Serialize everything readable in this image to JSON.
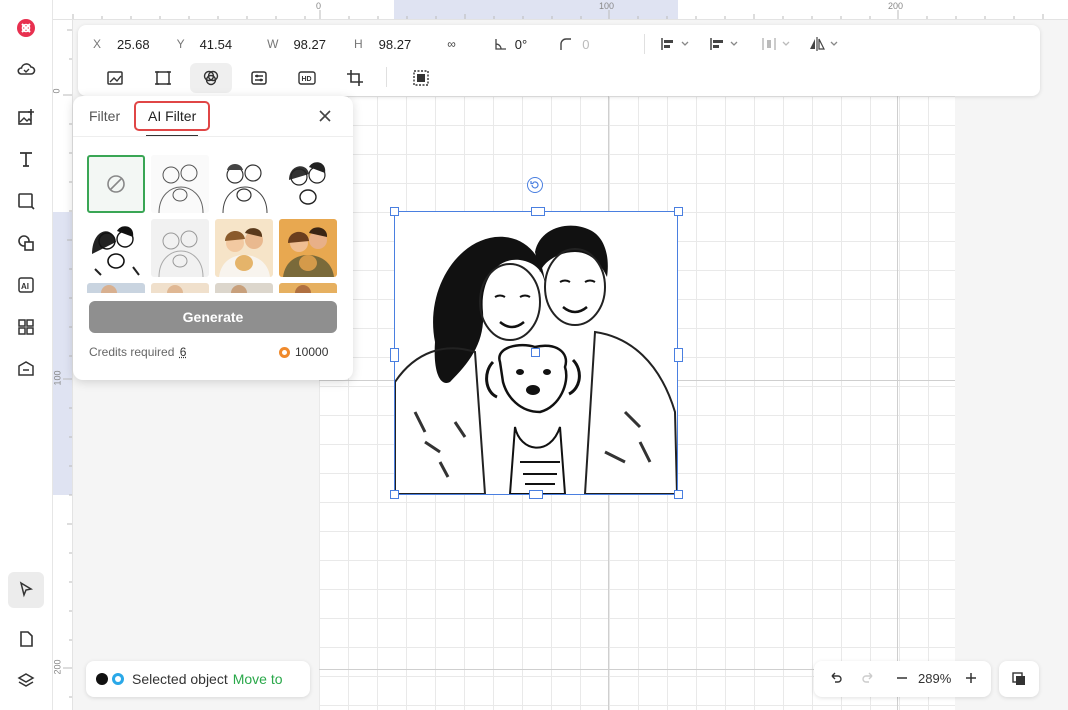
{
  "properties": {
    "x_label": "X",
    "x_value": "25.68",
    "y_label": "Y",
    "y_value": "41.54",
    "w_label": "W",
    "w_value": "98.27",
    "h_label": "H",
    "h_value": "98.27",
    "angle_value": "0°",
    "radius_value": "0"
  },
  "ruler": {
    "top_labels": [
      "0",
      "100",
      "200"
    ],
    "left_labels": [
      "0",
      "100",
      "200"
    ]
  },
  "ai_panel": {
    "tab_filter": "Filter",
    "tab_ai_filter": "AI Filter",
    "generate_label": "Generate",
    "credits_label": "Credits required",
    "credits_value": "6",
    "balance_value": "10000"
  },
  "status": {
    "selected_text": "Selected object",
    "move_to_text": "Move to"
  },
  "zoom": {
    "value": "289%"
  },
  "colors": {
    "accent_blue": "#4a7fe0",
    "brand_red": "#e8304f",
    "highlight_red": "#e04646",
    "green": "#2aa84a"
  }
}
